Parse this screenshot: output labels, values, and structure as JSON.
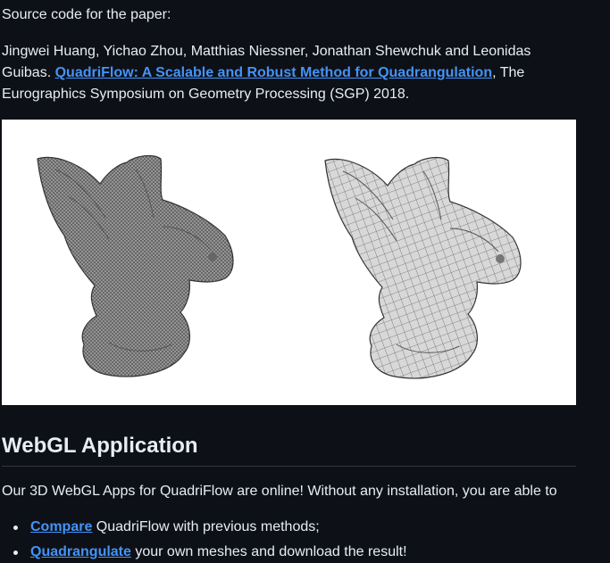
{
  "intro": {
    "source_text": "Source code for the paper:"
  },
  "citation": {
    "authors": "Jingwei Huang, Yichao Zhou, Matthias Niessner, Jonathan Shewchuk and Leonidas Guibas.",
    "paper_link": "QuadriFlow: A Scalable and Robust Method for Quadrangulation",
    "venue": ", The Eurographics Symposium on Geometry Processing (SGP) 2018."
  },
  "figure": {
    "left_icon": "gargoyle-triangle-mesh",
    "right_icon": "gargoyle-quad-mesh"
  },
  "section": {
    "heading": "WebGL Application",
    "description": "Our 3D WebGL Apps for QuadriFlow are online! Without any installation, you are able to"
  },
  "list": {
    "items": [
      {
        "link": "Compare",
        "text": " QuadriFlow with previous methods;"
      },
      {
        "link": "Quadrangulate",
        "text": " your own meshes and download the result!"
      }
    ]
  },
  "colors": {
    "background": "#0d1117",
    "text": "#e6edf3",
    "link": "#4493f8",
    "rule": "#30363d"
  }
}
